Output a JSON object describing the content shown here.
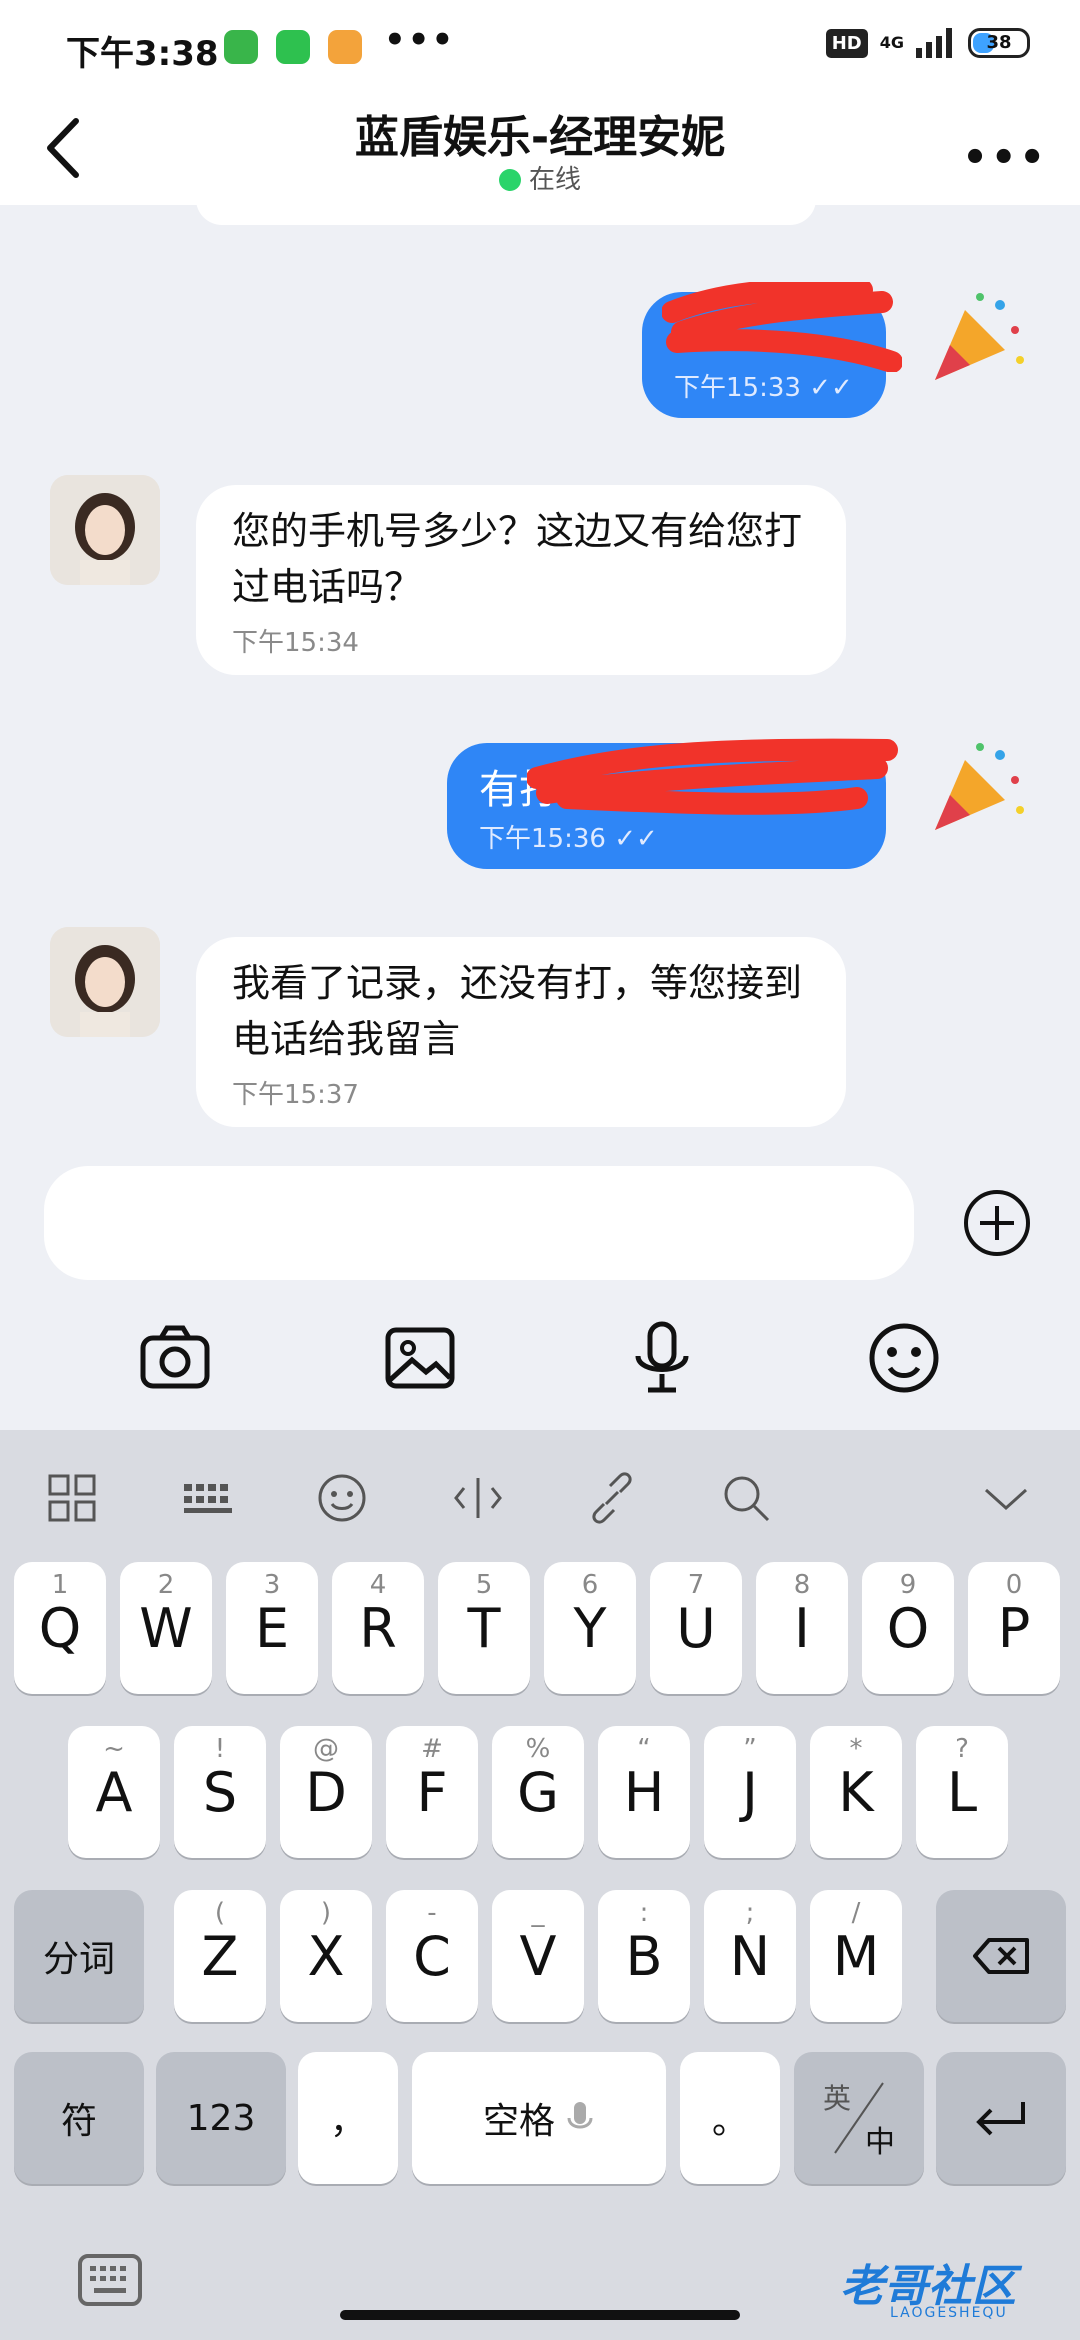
{
  "status_bar": {
    "time": "下午3:38",
    "dots": "•••",
    "hd": "HD",
    "network": "4G",
    "battery": "38"
  },
  "header": {
    "title": "蓝盾娱乐-经理安妮",
    "status": "在线",
    "more": "•••"
  },
  "messages": [
    {
      "side": "out",
      "text": "",
      "time": "下午15:33"
    },
    {
      "side": "in",
      "text": "您的手机号多少？这边又有给您打过电话吗？",
      "time": "下午15:34"
    },
    {
      "side": "out",
      "text": "有打",
      "time": "下午15:36"
    },
    {
      "side": "in",
      "text": "我看了记录，还没有打，等您接到电话给我留言",
      "time": "下午15:37"
    }
  ],
  "input": {
    "placeholder": ""
  },
  "keyboard": {
    "row1": [
      {
        "main": "Q",
        "sub": "1"
      },
      {
        "main": "W",
        "sub": "2"
      },
      {
        "main": "E",
        "sub": "3"
      },
      {
        "main": "R",
        "sub": "4"
      },
      {
        "main": "T",
        "sub": "5"
      },
      {
        "main": "Y",
        "sub": "6"
      },
      {
        "main": "U",
        "sub": "7"
      },
      {
        "main": "I",
        "sub": "8"
      },
      {
        "main": "O",
        "sub": "9"
      },
      {
        "main": "P",
        "sub": "0"
      }
    ],
    "row2": [
      {
        "main": "A",
        "sub": "~"
      },
      {
        "main": "S",
        "sub": "!"
      },
      {
        "main": "D",
        "sub": "@"
      },
      {
        "main": "F",
        "sub": "#"
      },
      {
        "main": "G",
        "sub": "%"
      },
      {
        "main": "H",
        "sub": "“"
      },
      {
        "main": "J",
        "sub": "”"
      },
      {
        "main": "K",
        "sub": "*"
      },
      {
        "main": "L",
        "sub": "?"
      }
    ],
    "row3": [
      {
        "main": "Z",
        "sub": "("
      },
      {
        "main": "X",
        "sub": ")"
      },
      {
        "main": "C",
        "sub": "-"
      },
      {
        "main": "V",
        "sub": "_"
      },
      {
        "main": "B",
        "sub": ":"
      },
      {
        "main": "N",
        "sub": ";"
      },
      {
        "main": "M",
        "sub": "/"
      }
    ],
    "fenci": "分词",
    "fu": "符",
    "num": "123",
    "comma": "，",
    "space": "空格",
    "period": "。",
    "lang_top": "英",
    "lang_bottom": "中"
  },
  "watermark": {
    "text": "老哥社区",
    "sub": "LAOGESHEQU"
  }
}
